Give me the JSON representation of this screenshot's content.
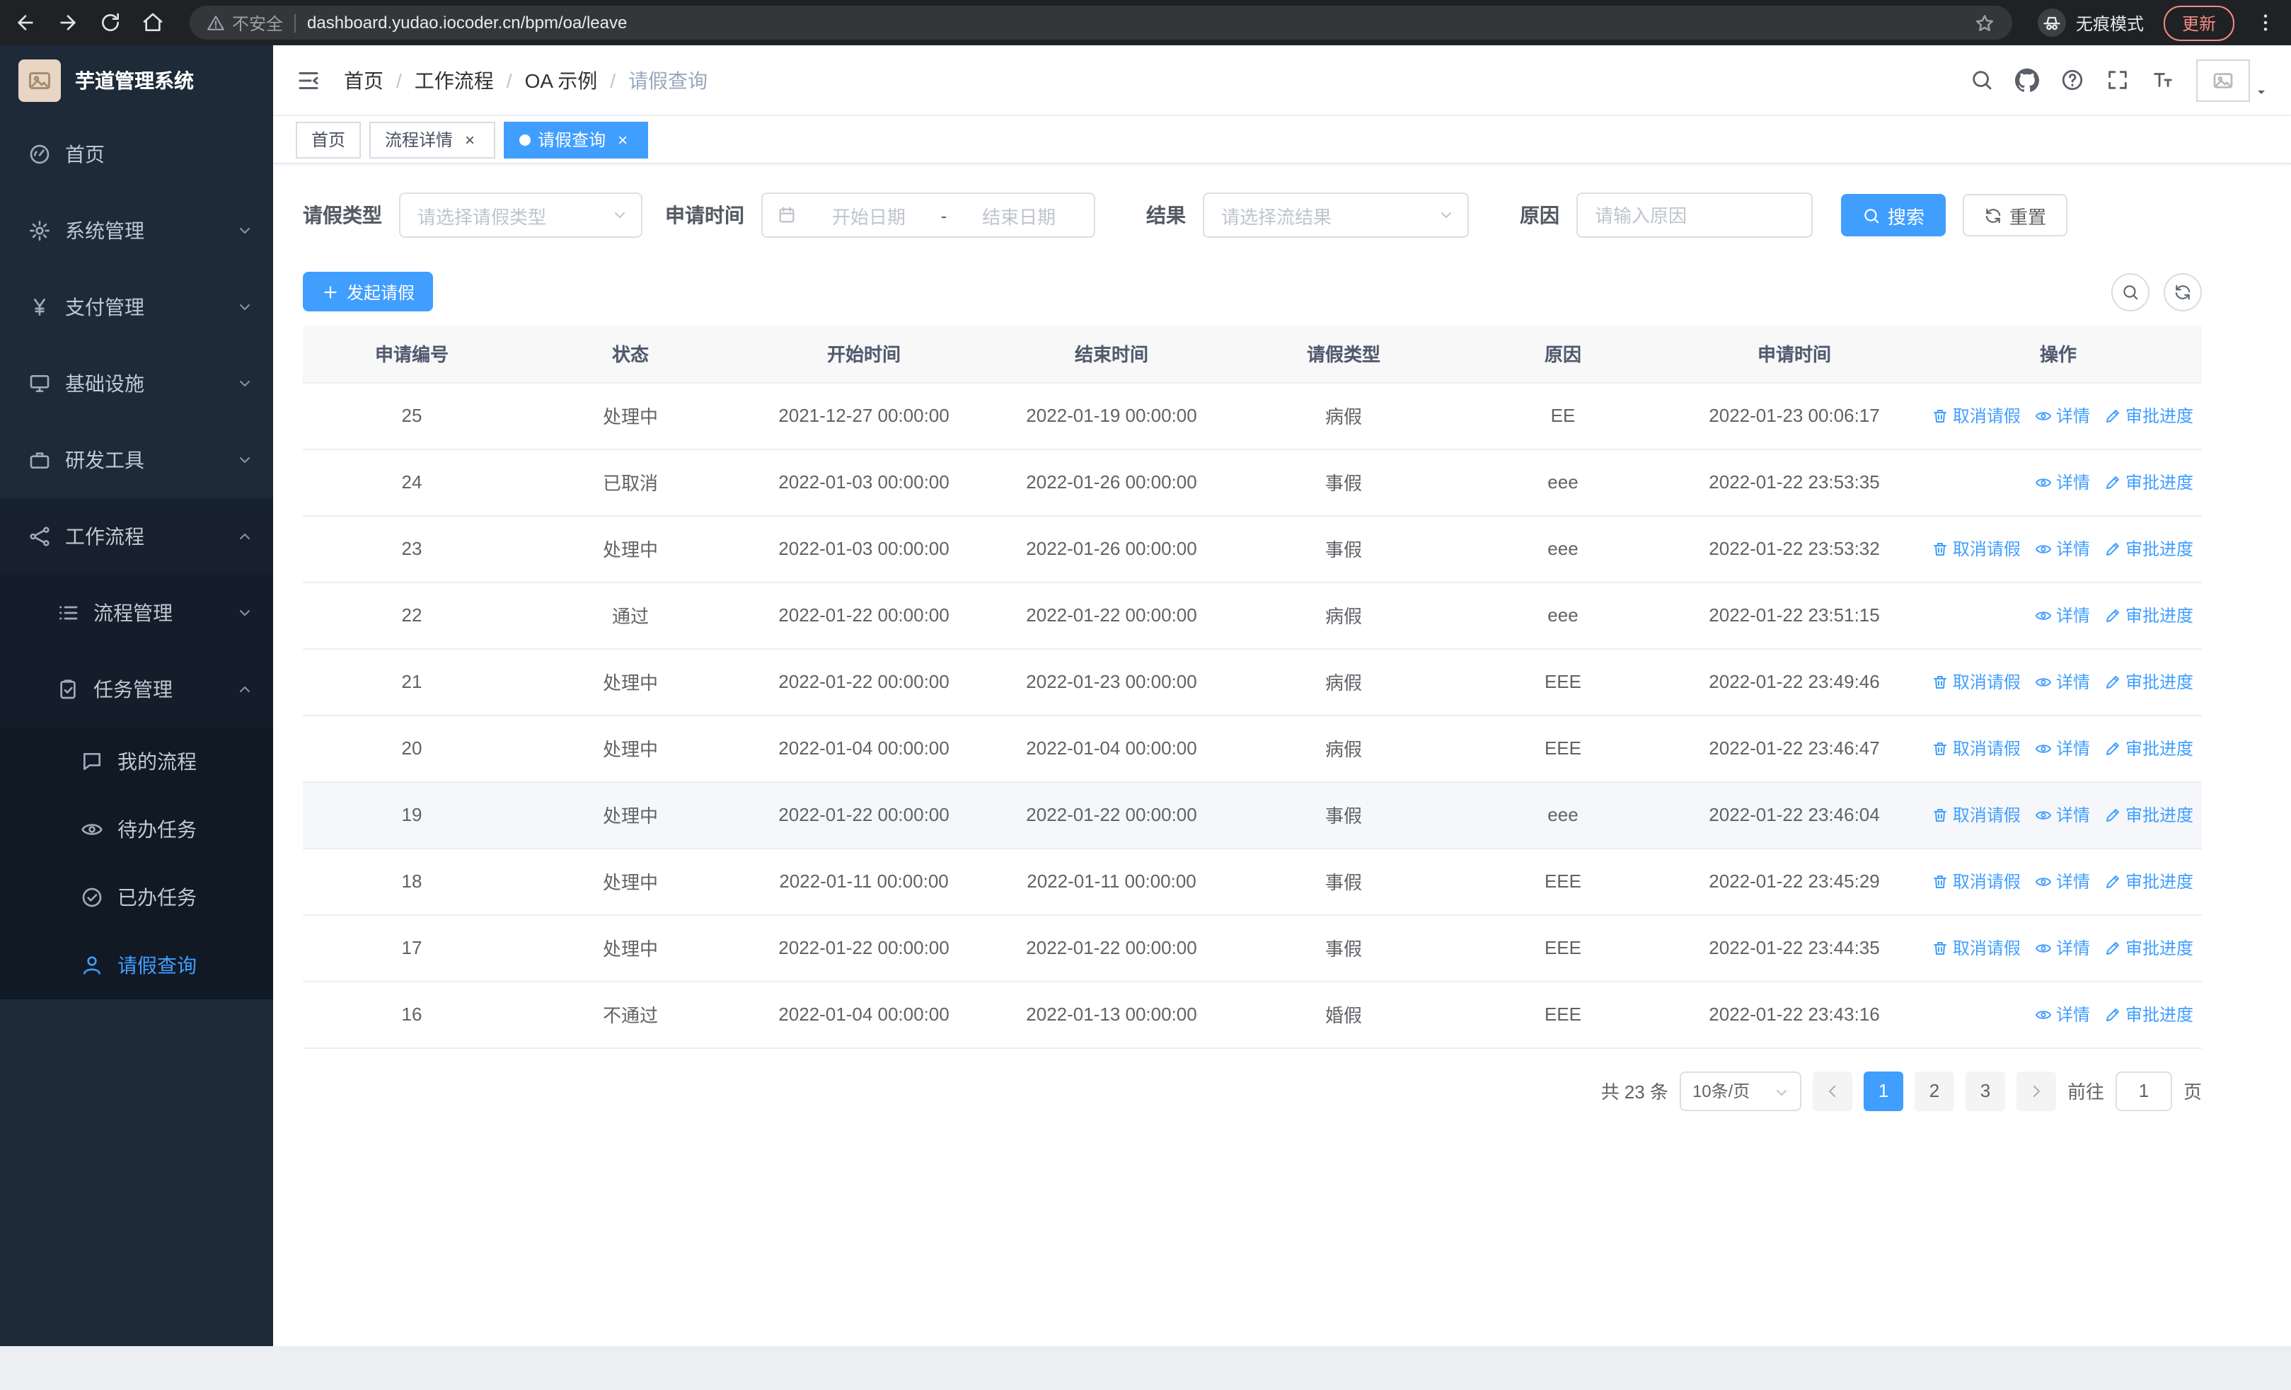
{
  "browser": {
    "security_label": "不安全",
    "url": "dashboard.yudao.iocoder.cn/bpm/oa/leave",
    "incognito_label": "无痕模式",
    "update_label": "更新"
  },
  "sidebar": {
    "logo_title": "芋道管理系统",
    "items": [
      {
        "key": "home",
        "label": "首页",
        "icon": "dashboard-icon",
        "level": 1
      },
      {
        "key": "system",
        "label": "系统管理",
        "icon": "gear-icon",
        "level": 1,
        "chevron": "down"
      },
      {
        "key": "payment",
        "label": "支付管理",
        "icon": "yen-icon",
        "level": 1,
        "chevron": "down"
      },
      {
        "key": "infrastructure",
        "label": "基础设施",
        "icon": "monitor-icon",
        "level": 1,
        "chevron": "down"
      },
      {
        "key": "dev-tools",
        "label": "研发工具",
        "icon": "suitcase-icon",
        "level": 1,
        "chevron": "down"
      },
      {
        "key": "workflow",
        "label": "工作流程",
        "icon": "workflow-icon",
        "level": 1,
        "chevron": "up",
        "expanded": true
      },
      {
        "key": "process-management",
        "label": "流程管理",
        "icon": "list-icon",
        "level": 2,
        "chevron": "down"
      },
      {
        "key": "task-management",
        "label": "任务管理",
        "icon": "task-icon",
        "level": 2,
        "chevron": "up",
        "expanded": true
      },
      {
        "key": "my-process",
        "label": "我的流程",
        "icon": "chat-icon",
        "level": 3
      },
      {
        "key": "todo-tasks",
        "label": "待办任务",
        "icon": "eye-icon",
        "level": 3
      },
      {
        "key": "done-tasks",
        "label": "已办任务",
        "icon": "check-circle-icon",
        "level": 3
      },
      {
        "key": "leave-query",
        "label": "请假查询",
        "icon": "user-icon",
        "level": 3,
        "active": true
      }
    ]
  },
  "header": {
    "breadcrumb": [
      {
        "label": "首页"
      },
      {
        "label": "工作流程"
      },
      {
        "label": "OA 示例"
      },
      {
        "label": "请假查询"
      }
    ],
    "breadcrumb_separator": "/",
    "icons": [
      "search-icon",
      "github-icon",
      "question-icon",
      "fullscreen-icon",
      "font-size-icon"
    ]
  },
  "tabs": [
    {
      "key": "home",
      "label": "首页",
      "closable": false,
      "active": false
    },
    {
      "key": "process-detail",
      "label": "流程详情",
      "closable": true,
      "active": false
    },
    {
      "key": "leave-query",
      "label": "请假查询",
      "closable": true,
      "active": true
    }
  ],
  "filters": {
    "leave_type_label": "请假类型",
    "leave_type_placeholder": "请选择请假类型",
    "apply_time_label": "申请时间",
    "start_date_placeholder": "开始日期",
    "range_separator": "-",
    "end_date_placeholder": "结束日期",
    "result_label": "结果",
    "result_placeholder": "请选择流结果",
    "reason_label": "原因",
    "reason_placeholder": "请输入原因",
    "search_label": "搜索",
    "reset_label": "重置"
  },
  "toolbar": {
    "create_label": "发起请假"
  },
  "table": {
    "columns": [
      "申请编号",
      "状态",
      "开始时间",
      "结束时间",
      "请假类型",
      "原因",
      "申请时间",
      "操作"
    ],
    "actions": {
      "cancel": "取消请假",
      "detail": "详情",
      "progress": "审批进度"
    },
    "rows": [
      {
        "id": "25",
        "status": "处理中",
        "start": "2021-12-27 00:00:00",
        "end": "2022-01-19 00:00:00",
        "type": "病假",
        "reason": "EE",
        "applied": "2022-01-23 00:06:17",
        "can_cancel": true
      },
      {
        "id": "24",
        "status": "已取消",
        "start": "2022-01-03 00:00:00",
        "end": "2022-01-26 00:00:00",
        "type": "事假",
        "reason": "eee",
        "applied": "2022-01-22 23:53:35",
        "can_cancel": false
      },
      {
        "id": "23",
        "status": "处理中",
        "start": "2022-01-03 00:00:00",
        "end": "2022-01-26 00:00:00",
        "type": "事假",
        "reason": "eee",
        "applied": "2022-01-22 23:53:32",
        "can_cancel": true
      },
      {
        "id": "22",
        "status": "通过",
        "start": "2022-01-22 00:00:00",
        "end": "2022-01-22 00:00:00",
        "type": "病假",
        "reason": "eee",
        "applied": "2022-01-22 23:51:15",
        "can_cancel": false
      },
      {
        "id": "21",
        "status": "处理中",
        "start": "2022-01-22 00:00:00",
        "end": "2022-01-23 00:00:00",
        "type": "病假",
        "reason": "EEE",
        "applied": "2022-01-22 23:49:46",
        "can_cancel": true
      },
      {
        "id": "20",
        "status": "处理中",
        "start": "2022-01-04 00:00:00",
        "end": "2022-01-04 00:00:00",
        "type": "病假",
        "reason": "EEE",
        "applied": "2022-01-22 23:46:47",
        "can_cancel": true
      },
      {
        "id": "19",
        "status": "处理中",
        "start": "2022-01-22 00:00:00",
        "end": "2022-01-22 00:00:00",
        "type": "事假",
        "reason": "eee",
        "applied": "2022-01-22 23:46:04",
        "can_cancel": true,
        "highlight": true
      },
      {
        "id": "18",
        "status": "处理中",
        "start": "2022-01-11 00:00:00",
        "end": "2022-01-11 00:00:00",
        "type": "事假",
        "reason": "EEE",
        "applied": "2022-01-22 23:45:29",
        "can_cancel": true
      },
      {
        "id": "17",
        "status": "处理中",
        "start": "2022-01-22 00:00:00",
        "end": "2022-01-22 00:00:00",
        "type": "事假",
        "reason": "EEE",
        "applied": "2022-01-22 23:44:35",
        "can_cancel": true
      },
      {
        "id": "16",
        "status": "不通过",
        "start": "2022-01-04 00:00:00",
        "end": "2022-01-13 00:00:00",
        "type": "婚假",
        "reason": "EEE",
        "applied": "2022-01-22 23:43:16",
        "can_cancel": false
      }
    ]
  },
  "pagination": {
    "total_label": "共 23 条",
    "page_size": "10条/页",
    "pages": [
      "1",
      "2",
      "3"
    ],
    "active_page": "1",
    "goto_label": "前往",
    "goto_value": "1",
    "page_suffix": "页"
  }
}
